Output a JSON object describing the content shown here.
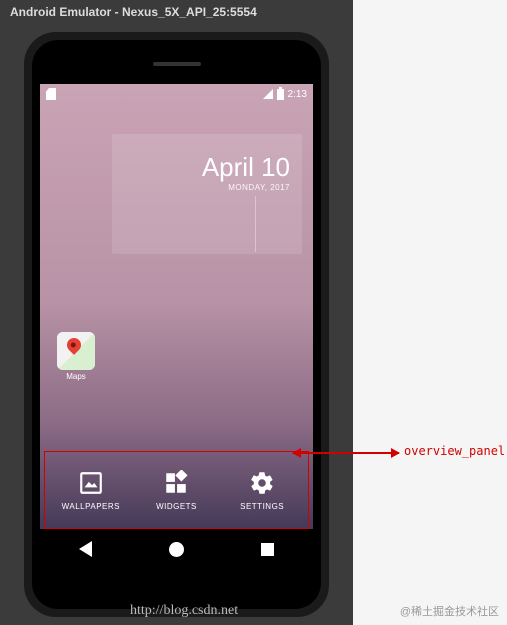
{
  "window": {
    "title": "Android Emulator - Nexus_5X_API_25:5554"
  },
  "status_bar": {
    "time": "2:13"
  },
  "clock_widget": {
    "date": "April 10",
    "day": "MONDAY, 2017"
  },
  "homescreen": {
    "apps": [
      {
        "label": "Maps"
      }
    ]
  },
  "overview_panel": {
    "items": [
      {
        "label": "WALLPAPERS",
        "icon": "wallpaper-icon"
      },
      {
        "label": "WIDGETS",
        "icon": "widgets-icon"
      },
      {
        "label": "SETTINGS",
        "icon": "settings-icon"
      }
    ]
  },
  "annotation": {
    "label": "overview_panel"
  },
  "watermark": {
    "url": "http://blog.csdn.net",
    "text": "@稀土掘金技术社区"
  }
}
